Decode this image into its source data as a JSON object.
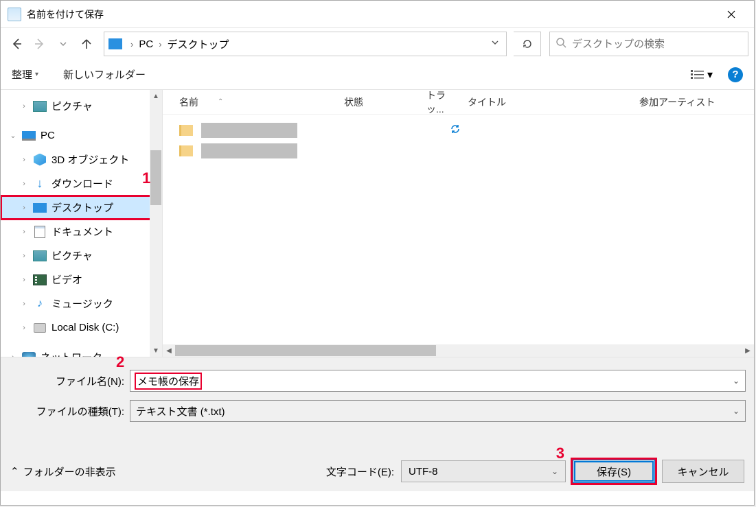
{
  "title": "名前を付けて保存",
  "nav": {
    "breadcrumb": {
      "root": "PC",
      "current": "デスクトップ"
    }
  },
  "search": {
    "placeholder": "デスクトップの検索"
  },
  "toolbar": {
    "organize": "整理",
    "newfolder": "新しいフォルダー"
  },
  "tree": {
    "items": [
      {
        "label": "ピクチャ",
        "icon": "pic",
        "level": 2,
        "chev": ">"
      },
      {
        "label": "PC",
        "icon": "pc",
        "level": 1,
        "chev": "v"
      },
      {
        "label": "3D オブジェクト",
        "icon": "3d",
        "level": 2,
        "chev": ">"
      },
      {
        "label": "ダウンロード",
        "icon": "dl",
        "level": 2,
        "chev": ">"
      },
      {
        "label": "デスクトップ",
        "icon": "desk",
        "level": 2,
        "chev": ">",
        "selected": true,
        "hilite": true
      },
      {
        "label": "ドキュメント",
        "icon": "doc",
        "level": 2,
        "chev": ">"
      },
      {
        "label": "ピクチャ",
        "icon": "pic",
        "level": 2,
        "chev": ">"
      },
      {
        "label": "ビデオ",
        "icon": "vid",
        "level": 2,
        "chev": ">"
      },
      {
        "label": "ミュージック",
        "icon": "mus",
        "level": 2,
        "chev": ">"
      },
      {
        "label": "Local Disk (C:)",
        "icon": "disk",
        "level": 2,
        "chev": ">"
      },
      {
        "label": "ネットワーク",
        "icon": "net",
        "level": 1,
        "chev": ">"
      }
    ]
  },
  "columns": {
    "name": "名前",
    "state": "状態",
    "track": "トラッ...",
    "title": "タイトル",
    "artist": "参加アーティスト"
  },
  "form": {
    "filename_label": "ファイル名(N):",
    "filename_value": "メモ帳の保存",
    "filetype_label": "ファイルの種類(T):",
    "filetype_value": "テキスト文書 (*.txt)",
    "encoding_label": "文字コード(E):",
    "encoding_value": "UTF-8",
    "hide_folders": "フォルダーの非表示",
    "save": "保存(S)",
    "cancel": "キャンセル"
  },
  "annotations": {
    "n1": "1",
    "n2": "2",
    "n3": "3"
  }
}
